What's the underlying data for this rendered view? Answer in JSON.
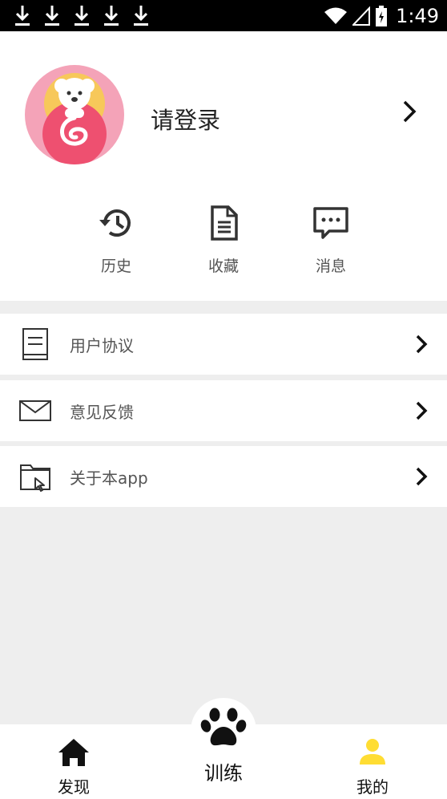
{
  "status_bar": {
    "time": "1:49",
    "notification_icons": [
      "download-icon",
      "download-icon",
      "download-icon",
      "download-icon",
      "download-icon"
    ]
  },
  "profile": {
    "login_prompt": "请登录"
  },
  "quick_actions": [
    {
      "label": "历史",
      "icon": "history-icon"
    },
    {
      "label": "收藏",
      "icon": "document-icon"
    },
    {
      "label": "消息",
      "icon": "message-icon"
    }
  ],
  "menu": [
    {
      "label": "用户协议",
      "icon": "book-icon"
    },
    {
      "label": "意见反馈",
      "icon": "mail-icon"
    },
    {
      "label": "关于本app",
      "icon": "folder-icon"
    }
  ],
  "tab_bar": {
    "discover": "发现",
    "train": "训练",
    "mine": "我的",
    "active_color": "#ffdd33"
  }
}
